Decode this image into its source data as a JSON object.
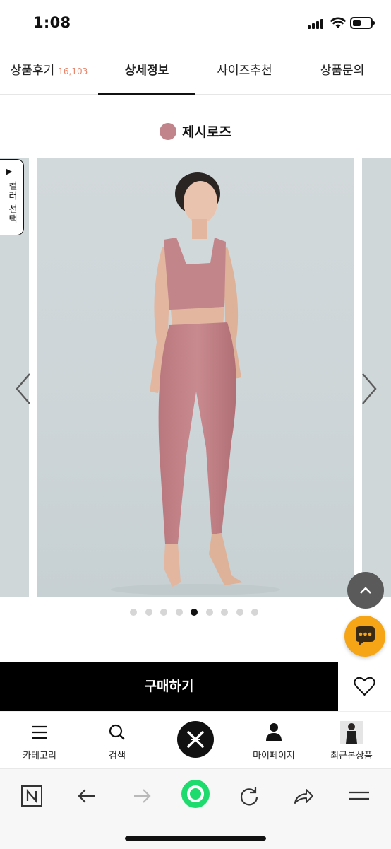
{
  "status_bar": {
    "time": "1:08"
  },
  "tabs": [
    {
      "label": "상품후기",
      "count": "16,103"
    },
    {
      "label": "상세정보",
      "count": ""
    },
    {
      "label": "사이즈추천",
      "count": ""
    },
    {
      "label": "상품문의",
      "count": ""
    }
  ],
  "active_tab": "상세정보",
  "product": {
    "color_name": "제시로즈",
    "swatch_color": "#c0848a",
    "color_select_label": "컬러 선택",
    "color_select_icon": "play-triangle-icon",
    "carousel": {
      "slide_count": 9,
      "active_index": 4
    }
  },
  "purchase": {
    "buy_label": "구매하기",
    "wishlist_icon": "heart-icon"
  },
  "bottom_nav": [
    {
      "label": "카테고리",
      "icon": "menu-icon"
    },
    {
      "label": "검색",
      "icon": "search-icon"
    },
    {
      "label": "",
      "icon": "brand-logo-icon"
    },
    {
      "label": "마이페이지",
      "icon": "person-icon"
    },
    {
      "label": "최근본상품",
      "icon": "recent-product-thumbnail"
    }
  ],
  "browser_toolbar": [
    {
      "icon": "naver-n-icon"
    },
    {
      "icon": "back-arrow-icon"
    },
    {
      "icon": "forward-arrow-icon"
    },
    {
      "icon": "green-home-icon"
    },
    {
      "icon": "refresh-icon"
    },
    {
      "icon": "share-icon"
    },
    {
      "icon": "hamburger-menu-icon"
    }
  ],
  "colors": {
    "accent_count": "#e8866a",
    "chat_button": "#f5a516",
    "buy_button": "#000000"
  }
}
